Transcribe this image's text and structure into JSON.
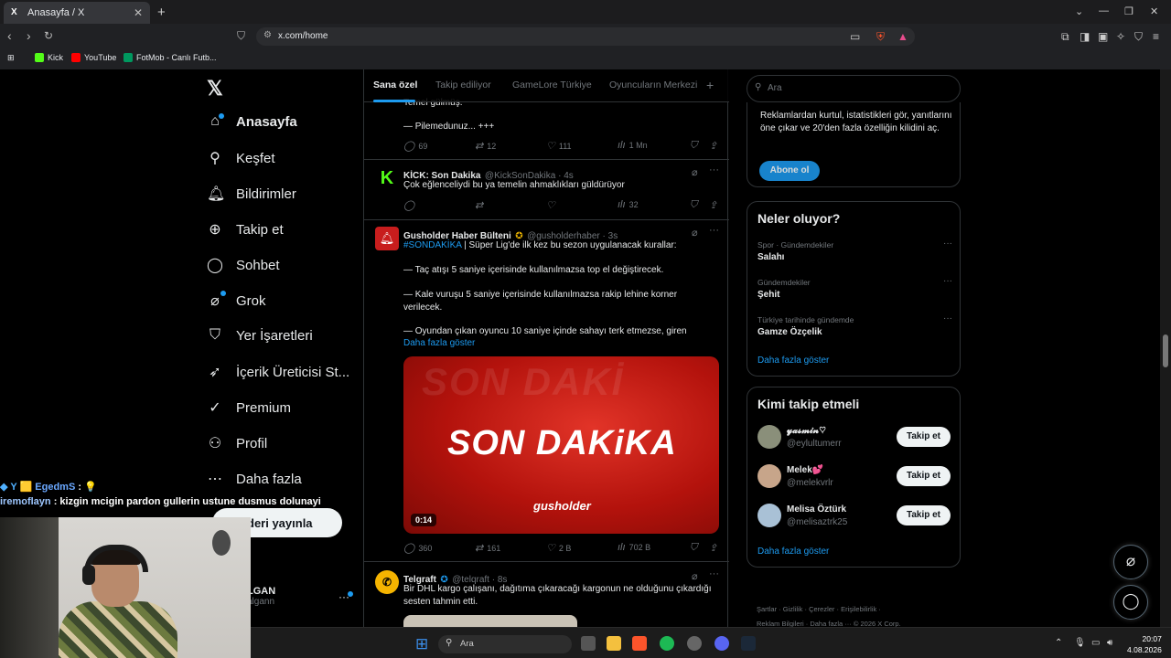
{
  "browser": {
    "tab_title": "Anasayfa / X",
    "tab_icon": "X",
    "tab_close": "✕",
    "new_tab": "+",
    "url": "x.com/home",
    "bookmarks": [
      {
        "label": "Kick",
        "color": "#53fc18"
      },
      {
        "label": "YouTube",
        "color": "#ff0000"
      },
      {
        "label": "FotMob - Canlı Futb...",
        "color": "#00985f"
      }
    ]
  },
  "nav": {
    "logo": "𝕏",
    "items": [
      {
        "label": "Anasayfa",
        "icon": "⌂",
        "active": true
      },
      {
        "label": "Keşfet",
        "icon": "⚲"
      },
      {
        "label": "Bildirimler",
        "icon": "🔔︎"
      },
      {
        "label": "Takip et",
        "icon": "⊕"
      },
      {
        "label": "Sohbet",
        "icon": "◯"
      },
      {
        "label": "Grok",
        "icon": "⌀"
      },
      {
        "label": "Yer İşaretleri",
        "icon": "⛉"
      },
      {
        "label": "İçerik Üreticisi St...",
        "icon": "➶"
      },
      {
        "label": "Premium",
        "icon": "✓"
      },
      {
        "label": "Profil",
        "icon": "⚇"
      },
      {
        "label": "Daha fazla",
        "icon": "⋯"
      }
    ],
    "post_button": "deri yayınla",
    "account_name": "LGAN",
    "account_handle": "algann",
    "account_more": "···"
  },
  "tabs": {
    "items": [
      "Sana özel",
      "Takip ediliyor",
      "GameLore Türkiye",
      "Oyuncuların Merkezi"
    ],
    "plus": "+"
  },
  "tweets": {
    "t0": {
      "line1": "Temel gülmüş.",
      "line2": "— Pilemedunuz... +++",
      "replies": "69",
      "retweets": "12",
      "likes": "111",
      "views": "1 Mn"
    },
    "t1": {
      "name": "KİCK: Son Dakika",
      "handle": "@KickSonDakika · 4s",
      "avatar_letter": "K",
      "text": "Çok eğlenceliydi bu ya temelin ahmaklıkları güldürüyor",
      "views": "32"
    },
    "t2": {
      "name": "Gusholder Haber Bülteni",
      "handle": "@gusholderhaber · 3s",
      "hashtag": "#SONDAKİKA",
      "text1": " | Süper Lig'de ilk kez bu sezon uygulanacak kurallar:",
      "text2": "— Taç atışı 5 saniye içerisinde kullanılmazsa top el değiştirecek.",
      "text3": "— Kale vuruşu 5 saniye içerisinde kullanılmazsa rakip lehine korner verilecek.",
      "text4": "— Oyundan çıkan oyuncu 10 saniye içinde sahayı terk etmezse, giren",
      "show_more": "Daha fazla göster",
      "media_ghost": "SON DAKİ",
      "media_title": "SON DAKiKA",
      "media_brand": "gusholder",
      "duration": "0:14",
      "replies": "360",
      "retweets": "161",
      "likes": "2 B",
      "views": "702 B"
    },
    "t3": {
      "name": "Telgraft",
      "handle": "@telqraft · 8s",
      "text": "Bir DHL kargo çalışanı, dağıtıma çıkaracağı kargonun ne olduğunu çıkardığı sesten tahmin etti."
    }
  },
  "right": {
    "search_placeholder": "Ara",
    "promo_text": "Reklamlardan kurtul, istatistikleri gör, yanıtlarını öne çıkar ve 20'den fazla özelliğin kilidini aç.",
    "subscribe": "Abone ol",
    "trends_title": "Neler oluyor?",
    "trends": [
      {
        "category": "Spor · Gündemdekiler",
        "title": "Salahı"
      },
      {
        "category": "Gündemdekiler",
        "title": "Şehit"
      },
      {
        "category": "Türkiye tarihinde gündemde",
        "title": "Gamze Özçelik"
      }
    ],
    "trend_more": "···",
    "show_more": "Daha fazla göster",
    "who_title": "Kimi takip etmeli",
    "who": [
      {
        "name": "𝔂𝓪𝓼𝓶𝓲𝓷♡",
        "handle": "@eylultumerr",
        "color": "#8a8f7a"
      },
      {
        "name": "Melek💕",
        "handle": "@melekvrlr",
        "color": "#c7a58a"
      },
      {
        "name": "Melisa Öztürk",
        "handle": "@melisaztrk25",
        "color": "#a9c1d6"
      }
    ],
    "follow_label": "Takip et",
    "footer1": "Şartlar  ·  Gizlilik  ·  Çerezler  ·  Erişilebilirlik  ·",
    "footer2": "Reklam Bilgileri  ·  Daha fazla ···  © 2026 X Corp."
  },
  "stream": {
    "chat1_user": "EgedmS",
    "chat1_msg": " : 💡",
    "chat2_user": "iremoflayn",
    "chat2_msg": " : kizgin mcigin pardon gullerin ustune dusmus dolunayi"
  },
  "taskbar": {
    "search": "Ara",
    "time": "20:07",
    "date": "4.08.2026"
  }
}
